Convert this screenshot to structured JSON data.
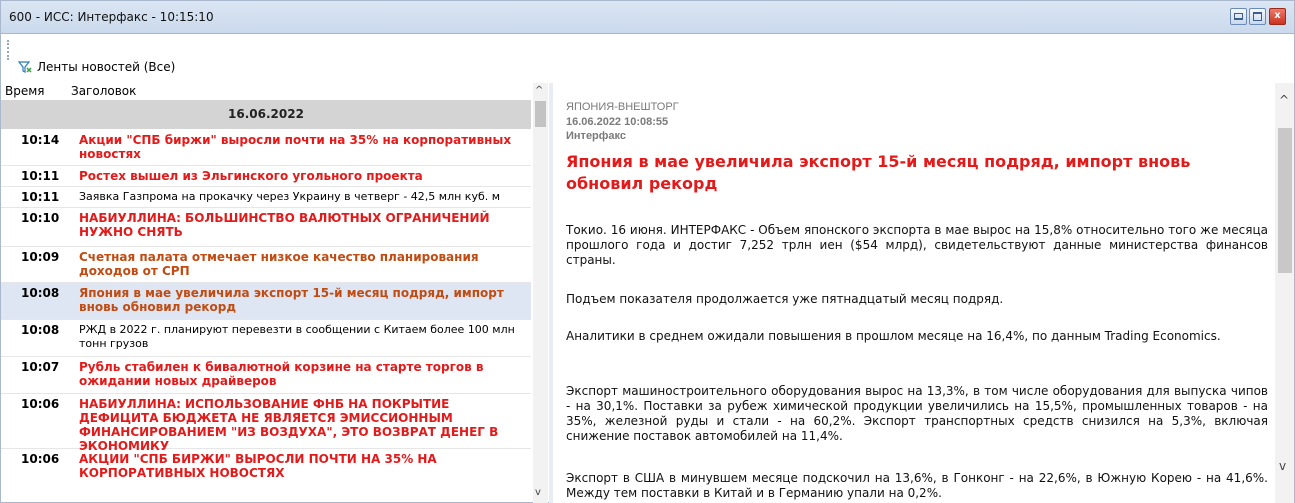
{
  "window": {
    "title": "600 - ИСС: Интерфакс - 10:15:10",
    "minimize_icon": "minimize-icon",
    "maximize_icon": "maximize-icon",
    "close_icon": "close-icon",
    "close_glyph": "x"
  },
  "toolbar": {
    "feeds_label": "Ленты новостей (Все)",
    "feeds_icon": "filter-icon"
  },
  "list": {
    "columns": {
      "time": "Время",
      "headline": "Заголовок"
    },
    "date": "16.06.2022",
    "items": [
      {
        "time": "10:14",
        "headline": "Акции \"СПБ биржи\" выросли почти на 35% на корпоративных новостях",
        "style": "red"
      },
      {
        "time": "10:11",
        "headline": "Ростех вышел из Эльгинского угольного проекта",
        "style": "red"
      },
      {
        "time": "10:11",
        "headline": "Заявка Газпрома на прокачку через Украину в четверг - 42,5 млн куб. м",
        "style": "plain"
      },
      {
        "time": "10:10",
        "headline": "НАБИУЛЛИНА: БОЛЬШИНСТВО ВАЛЮТНЫХ ОГРАНИЧЕНИЙ НУЖНО СНЯТЬ",
        "style": "red"
      },
      {
        "time": "10:09",
        "headline": "Счетная палата отмечает низкое качество планирования доходов от СРП",
        "style": "brown"
      },
      {
        "time": "10:08",
        "headline": "Япония в мае увеличила экспорт 15-й месяц подряд, импорт вновь обновил рекорд",
        "style": "brown",
        "selected": true
      },
      {
        "time": "10:08",
        "headline": "РЖД в 2022 г. планируют перевезти в сообщении с Китаем более 100 млн тонн грузов",
        "style": "plain"
      },
      {
        "time": "10:07",
        "headline": "Рубль стабилен к бивалютной корзине на старте торгов в ожидании новых драйверов",
        "style": "red"
      },
      {
        "time": "10:06",
        "headline": "НАБИУЛЛИНА: ИСПОЛЬЗОВАНИЕ ФНБ НА ПОКРЫТИЕ ДЕФИЦИТА БЮДЖЕТА НЕ ЯВЛЯЕТСЯ ЭМИССИОННЫМ ФИНАНСИРОВАНИЕМ \"ИЗ ВОЗДУХА\", ЭТО ВОЗВРАТ ДЕНЕГ В ЭКОНОМИКУ",
        "style": "red"
      },
      {
        "time": "10:06",
        "headline": "АКЦИИ \"СПБ БИРЖИ\" ВЫРОСЛИ ПОЧТИ НА 35% НА КОРПОРАТИВНЫХ НОВОСТЯХ",
        "style": "red"
      }
    ]
  },
  "article": {
    "rubric": "ЯПОНИЯ-ВНЕШТОРГ",
    "timestamp": "16.06.2022 10:08:55",
    "agency": "Интерфакс",
    "title": "Япония в мае увеличила экспорт 15-й месяц подряд, импорт вновь обновил рекорд",
    "paragraphs": [
      "Токио. 16 июня. ИНТЕРФАКС - Объем японского экспорта в мае вырос на 15,8% относительно того же месяца прошлого года и достиг 7,252 трлн иен ($54 млрд), свидетельствуют данные министерства финансов страны.",
      "Подъем показателя продолжается уже пятнадцатый месяц подряд.",
      "Аналитики в среднем ожидали повышения в прошлом месяце на 16,4%, по данным Trading Economics.",
      "Экспорт машиностроительного оборудования вырос на 13,3%, в том числе оборудования для выпуска чипов - на 30,1%. Поставки за рубеж химической продукции увеличились на 15,5%, промышленных товаров - на 35%, железной руды и стали - на 60,2%. Экспорт транспортных средств снизился на 5,3%, включая снижение поставок автомобилей на 11,4%.",
      "Экспорт в США в минувшем месяце подскочил на 13,6%, в Гонконг - на 22,6%, в Южную Корею - на 41,6%. Между тем поставки в Китай и в Германию упали на 0,2%."
    ]
  },
  "scrollbars": {
    "up_glyph": "^",
    "down_glyph": "v",
    "left_up_icon": "chevron-up-icon",
    "left_down_icon": "chevron-down-icon"
  },
  "colors": {
    "headline_red": "#e41a1a",
    "headline_brown": "#c24b12",
    "selected_row": "#dde6f2",
    "date_bar": "#d4d4d4"
  }
}
